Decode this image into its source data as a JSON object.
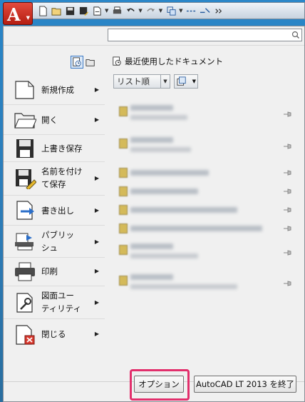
{
  "menu": {
    "items": [
      {
        "label": "新規作成",
        "icon": "new-file-icon",
        "has_submenu": true
      },
      {
        "label": "開く",
        "icon": "open-folder-icon",
        "has_submenu": true
      },
      {
        "label": "上書き保存",
        "icon": "save-disk-icon",
        "has_submenu": false
      },
      {
        "label_line1": "名前を付け",
        "label_line2": "て保存",
        "icon": "save-as-icon",
        "has_submenu": true
      },
      {
        "label": "書き出し",
        "icon": "export-icon",
        "has_submenu": true
      },
      {
        "label_line1": "パブリッ",
        "label_line2": "シュ",
        "icon": "publish-icon",
        "has_submenu": true
      },
      {
        "label": "印刷",
        "icon": "printer-icon",
        "has_submenu": true
      },
      {
        "label_line1": "図面ユー",
        "label_line2": "ティリティ",
        "icon": "drawing-utilities-icon",
        "has_submenu": true
      },
      {
        "label": "閉じる",
        "icon": "close-file-icon",
        "has_submenu": true
      }
    ]
  },
  "search": {
    "value": "",
    "placeholder": ""
  },
  "recent": {
    "title": "最近使用したドキュメント",
    "sort_value": "リスト順"
  },
  "buttons": {
    "options": "オプション",
    "exit": "AutoCAD LT 2013 を終了"
  },
  "colors": {
    "app_button": "#c8271c",
    "highlight": "#e22f6c",
    "desktop": "#2c7bb6"
  }
}
